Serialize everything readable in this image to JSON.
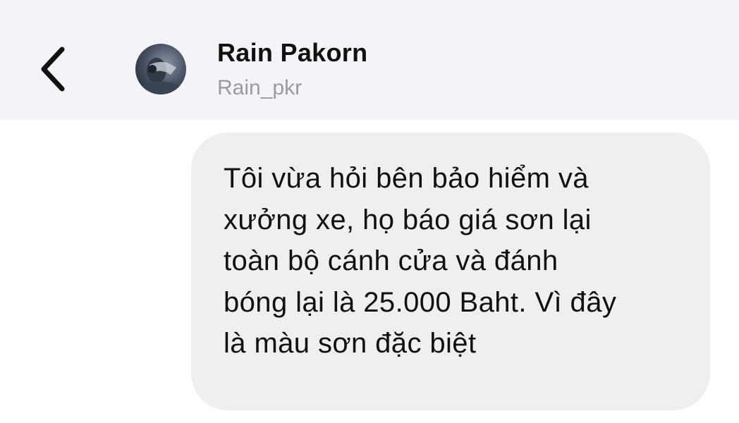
{
  "header": {
    "back_icon": "chevron-left-icon",
    "avatar_icon": "avatar",
    "name": "Rain Pakorn",
    "handle": "Rain_pkr"
  },
  "messages": [
    {
      "direction": "incoming",
      "text": "Tôi vừa hỏi bên bảo hiểm và\nxưởng xe, họ báo giá sơn lại\ntoàn bộ cánh cửa và đánh\nbóng lại là 25.000 Baht. Vì đây\nlà màu sơn đặc biệt"
    }
  ],
  "colors": {
    "header_bg": "#f3f3f8",
    "bubble_bg": "#efefef",
    "text": "#111111",
    "handle_text": "#9a9aa0"
  }
}
